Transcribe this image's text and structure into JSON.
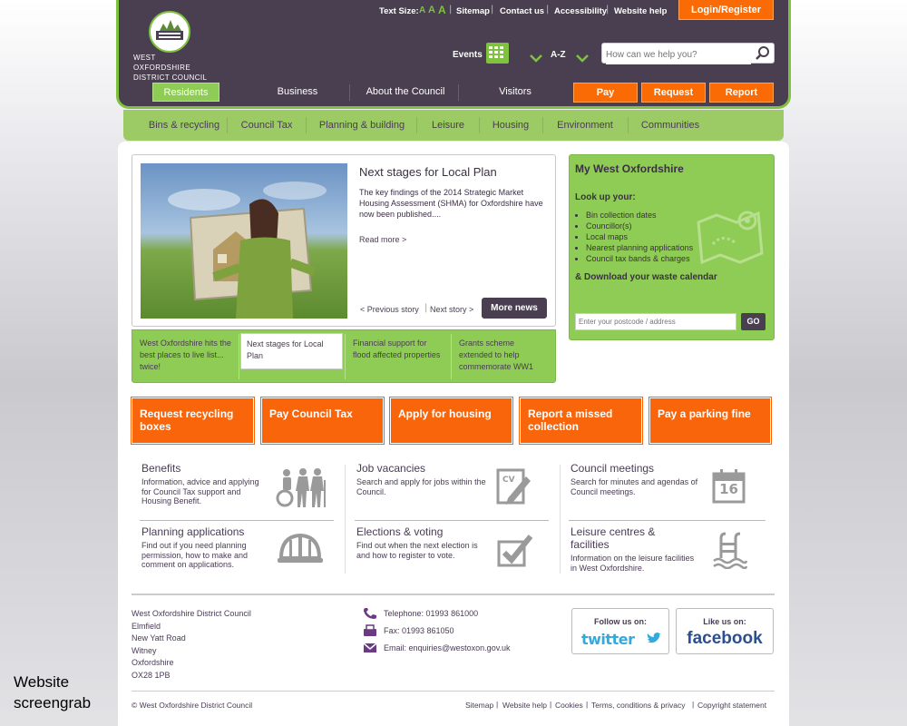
{
  "header": {
    "logo_line1": "WEST OXFORDSHIRE",
    "logo_line2": "DISTRICT COUNCIL",
    "text_size_label": "Text Size:",
    "text_size_options": [
      "A",
      "A",
      "A"
    ],
    "top_links": [
      "Sitemap",
      "Contact us",
      "Accessibility",
      "Website help"
    ],
    "login_label": "Login/Register",
    "events_label": "Events",
    "az_label": "A-Z",
    "search_placeholder": "How can we help you?"
  },
  "main_nav": {
    "items": [
      "Residents",
      "Business",
      "About the Council",
      "Visitors"
    ],
    "actions": [
      "Pay",
      "Request",
      "Report"
    ]
  },
  "sub_nav": [
    "Bins & recycling",
    "Council Tax",
    "Planning & building",
    "Leisure",
    "Housing",
    "Environment",
    "Communities"
  ],
  "featured": {
    "title": "Next stages for Local Plan",
    "body": "The key findings of the 2014 Strategic Market Housing Assessment (SHMA) for Oxfordshire have now been published....",
    "read_more": "Read more >",
    "prev": "< Previous story",
    "next": "Next story >",
    "more_news": "More news"
  },
  "story_tabs": [
    "West Oxfordshire hits the best places to live list... twice!",
    "Next stages for Local Plan",
    "Financial support for flood affected properties",
    "Grants scheme extended to help commemorate WW1"
  ],
  "my_wo": {
    "title": "My West Oxfordshire",
    "lookup": "Look up your:",
    "items": [
      "Bin collection dates",
      "Councillor(s)",
      "Local maps",
      "Nearest planning applications",
      "Council tax bands & charges"
    ],
    "download": "& Download your waste calendar",
    "postcode_placeholder": "Enter your postcode / address",
    "go": "GO"
  },
  "quick_links": [
    "Request recycling boxes",
    "Pay Council Tax",
    "Apply for housing",
    "Report a missed collection",
    "Pay a parking fine"
  ],
  "services": [
    {
      "title": "Benefits",
      "desc": "Information, advice and applying for Council Tax support and Housing Benefit.",
      "icon": "people-icon"
    },
    {
      "title": "Job vacancies",
      "desc": "Search and apply for jobs within the Council.",
      "icon": "cv-icon"
    },
    {
      "title": "Council meetings",
      "desc": "Search for minutes and agendas of Council meetings.",
      "icon": "calendar-icon",
      "icon_text": "16"
    },
    {
      "title": "Planning applications",
      "desc": "Find out if you need planning permission, how to make and comment on applications.",
      "icon": "hard-hat-icon"
    },
    {
      "title": "Elections & voting",
      "desc": "Find out when the next election is and how to register to vote.",
      "icon": "ballot-check-icon"
    },
    {
      "title": "Leisure centres & facilities",
      "desc": "Information on the leisure facilities in West Oxfordshire.",
      "icon": "swimming-pool-icon"
    }
  ],
  "footer": {
    "address": [
      "West Oxfordshire District Council",
      "Elmfield",
      "New Yatt Road",
      "Witney",
      "Oxfordshire",
      "OX28 1PB"
    ],
    "telephone": "Telephone: 01993 861000",
    "fax": "Fax: 01993 861050",
    "email": "Email: enquiries@westoxon.gov.uk",
    "follow_label": "Follow us on:",
    "twitter": "twitter",
    "like_label": "Like us on:",
    "facebook": "facebook",
    "copyright": "© West Oxfordshire District Council",
    "links": [
      "Sitemap",
      "Website help",
      "Cookies",
      "Terms, conditions & privacy",
      "Copyright statement"
    ]
  },
  "caption": "Website screengrab",
  "colors": {
    "header_bg": "#4a3f50",
    "green": "#8fcc55",
    "orange": "#fa6b06"
  }
}
